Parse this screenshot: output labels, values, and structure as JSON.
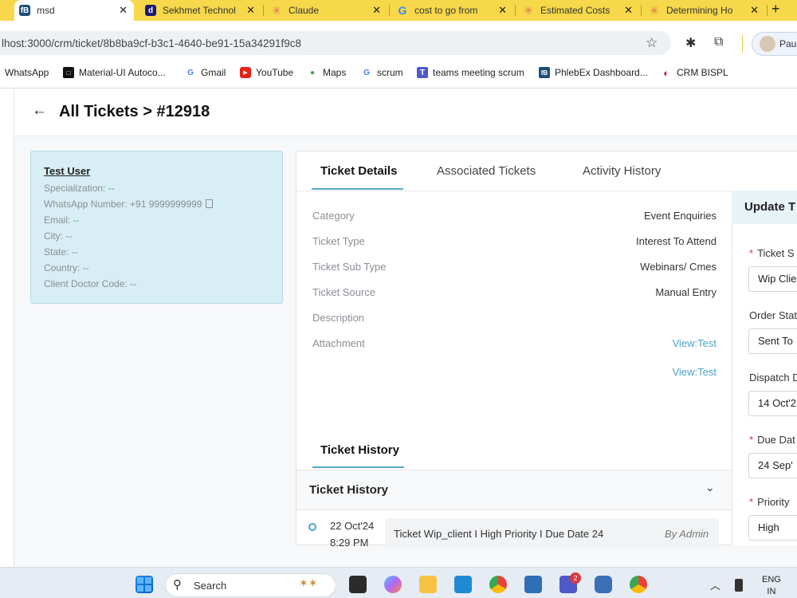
{
  "browser": {
    "tabs": [
      {
        "label": "msd",
        "fav": "fB",
        "color": "#1b4d7a"
      },
      {
        "label": "Sekhmet Technol",
        "fav": "d",
        "color": "#1a1a6e"
      },
      {
        "label": "Claude",
        "fav": "✳",
        "color": "#d9774a"
      },
      {
        "label": "cost to go from",
        "fav": "G",
        "color": "#4285f4"
      },
      {
        "label": "Estimated Costs",
        "fav": "✳",
        "color": "#d9774a"
      },
      {
        "label": "Determining Ho",
        "fav": "✳",
        "color": "#d9774a"
      }
    ],
    "new_tab": "+",
    "url": "lhost:3000/crm/ticket/8b8ba9cf-b3c1-4640-be91-15a34291f9c8",
    "profile_name": "Paus"
  },
  "bookmarks": [
    {
      "label": "WhatsApp",
      "fav": "",
      "color": "#ffffff"
    },
    {
      "label": "Material-UI Autoco...",
      "fav": "■",
      "color": "#111111"
    },
    {
      "label": "Gmail",
      "fav": "G",
      "color": "#4285f4"
    },
    {
      "label": "YouTube",
      "fav": "▶",
      "color": "#e62117"
    },
    {
      "label": "Maps",
      "fav": "●",
      "color": "#34a853"
    },
    {
      "label": "scrum",
      "fav": "G",
      "color": "#4285f4"
    },
    {
      "label": "teams meeting scrum",
      "fav": "T",
      "color": "#5059c9"
    },
    {
      "label": "PhlebEx Dashboard...",
      "fav": "fB",
      "color": "#1b4d7a"
    },
    {
      "label": "CRM BISPL",
      "fav": "◐",
      "color": "#c2185b"
    }
  ],
  "page": {
    "breadcrumb": "All Tickets > #12918"
  },
  "user": {
    "name": "Test User",
    "specialization": "Specialization: --",
    "whatsapp": "WhatsApp Number: +91 9999999999",
    "email": "Email: --",
    "city": "City: --",
    "state": "State: --",
    "country": "Country: --",
    "client_doctor_code": "Client Doctor Code: --"
  },
  "panel_tabs": [
    "Ticket Details",
    "Associated Tickets",
    "Activity History"
  ],
  "details": [
    {
      "label": "Category",
      "value": "Event Enquiries"
    },
    {
      "label": "Ticket Type",
      "value": "Interest To Attend"
    },
    {
      "label": "Ticket Sub Type",
      "value": "Webinars/ Cmes"
    },
    {
      "label": "Ticket Source",
      "value": "Manual Entry"
    },
    {
      "label": "Description",
      "value": ""
    },
    {
      "label": "Attachment",
      "value": "View:Test"
    }
  ],
  "attachment_extra": "View:Test",
  "history": {
    "tab": "Ticket History",
    "accordion_title": "Ticket History",
    "entries": [
      {
        "date": "22 Oct'24",
        "time": "8:29 PM",
        "text": "Ticket Wip_client I High Priority I Due Date 24",
        "by": "By Admin"
      }
    ]
  },
  "update": {
    "title": "Update T",
    "fields": [
      {
        "label": "Ticket S",
        "required": true,
        "value": "Wip Clie"
      },
      {
        "label": "Order Stat",
        "required": false,
        "value": "Sent To"
      },
      {
        "label": "Dispatch D",
        "required": false,
        "value": "14 Oct'2"
      },
      {
        "label": "Due Dat",
        "required": true,
        "value": "24 Sep'"
      },
      {
        "label": "Priority",
        "required": true,
        "value": "High"
      }
    ]
  },
  "taskbar": {
    "search": "Search",
    "lang_top": "ENG",
    "lang_bottom": "IN",
    "teams_badge": "2"
  }
}
